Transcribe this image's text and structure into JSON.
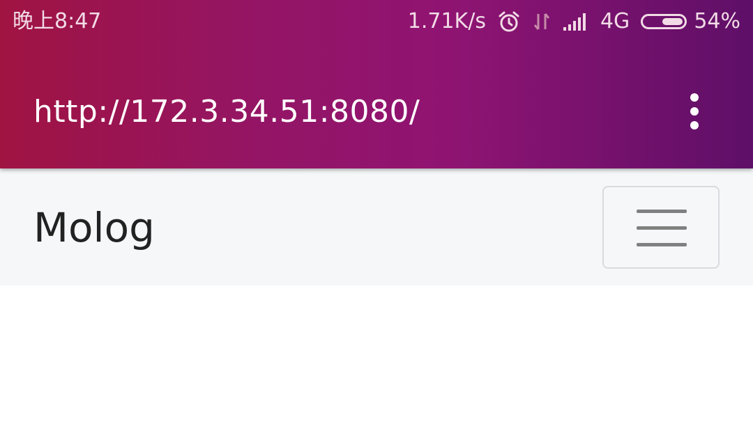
{
  "status_bar": {
    "time": "晚上8:47",
    "network_speed": "1.71K/s",
    "network_type": "4G",
    "battery_percent": "54%",
    "battery_level": 0.54,
    "icons": [
      "alarm-icon",
      "data-transfer-icon",
      "signal-icon",
      "battery-icon"
    ]
  },
  "browser": {
    "url": "http://172.3.34.51:8080/",
    "menu_icon": "more-vert-icon",
    "colors": {
      "gradient_start": "#a01442",
      "gradient_mid": "#8f1472",
      "gradient_end": "#5e0f68"
    }
  },
  "site_navbar": {
    "brand": "Molog",
    "toggle_icon": "hamburger-menu-icon",
    "background": "#f5f7f9"
  }
}
